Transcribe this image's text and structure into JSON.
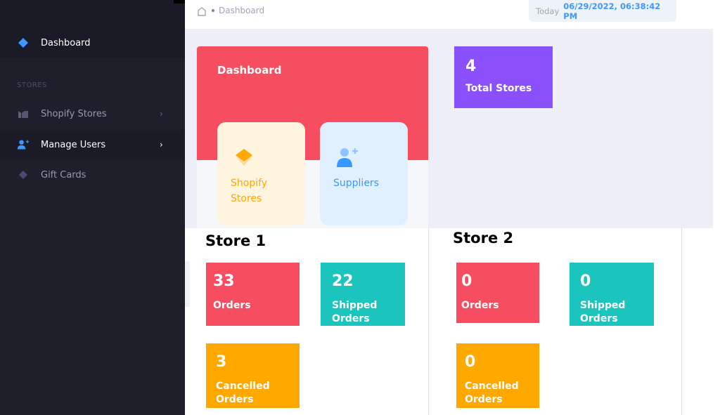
{
  "sidebar": {
    "items": [
      {
        "label": "Dashboard",
        "icon": "layers-icon"
      },
      {
        "label": "Shopify Stores",
        "icon": "store-icon"
      },
      {
        "label": "Manage Users",
        "icon": "add-user-icon"
      },
      {
        "label": "Gift Cards",
        "icon": "diamond-icon"
      }
    ],
    "section_label": "STORES",
    "chevron": "›"
  },
  "header": {
    "breadcrumb": "Dashboard",
    "today_label": "Today",
    "today_value": "06/29/2022, 06:38:42 PM"
  },
  "dashboard_card": {
    "title": "Dashboard",
    "tiles": [
      {
        "label": "Shopify Stores",
        "icon": "layers-icon"
      },
      {
        "label": "Suppliers",
        "icon": "add-user-icon"
      }
    ]
  },
  "total_stores": {
    "value": "4",
    "label": "Total Stores"
  },
  "stores": [
    {
      "name": "Store 1",
      "stats": [
        {
          "value": "33",
          "label": "Orders"
        },
        {
          "value": "22",
          "label": "Shipped Orders"
        },
        {
          "value": "3",
          "label": "Cancelled Orders"
        }
      ]
    },
    {
      "name": "Store 2",
      "stats": [
        {
          "value": "0",
          "label": "Orders"
        },
        {
          "value": "0",
          "label": "Shipped Orders"
        },
        {
          "value": "0",
          "label": "Cancelled Orders"
        }
      ]
    }
  ],
  "colors": {
    "sidebar_bg": "#1f1f2c",
    "danger": "#f64e60",
    "teal": "#1bc5bd",
    "warning": "#ffa800",
    "purple": "#8950fc",
    "primary": "#3699ff"
  }
}
